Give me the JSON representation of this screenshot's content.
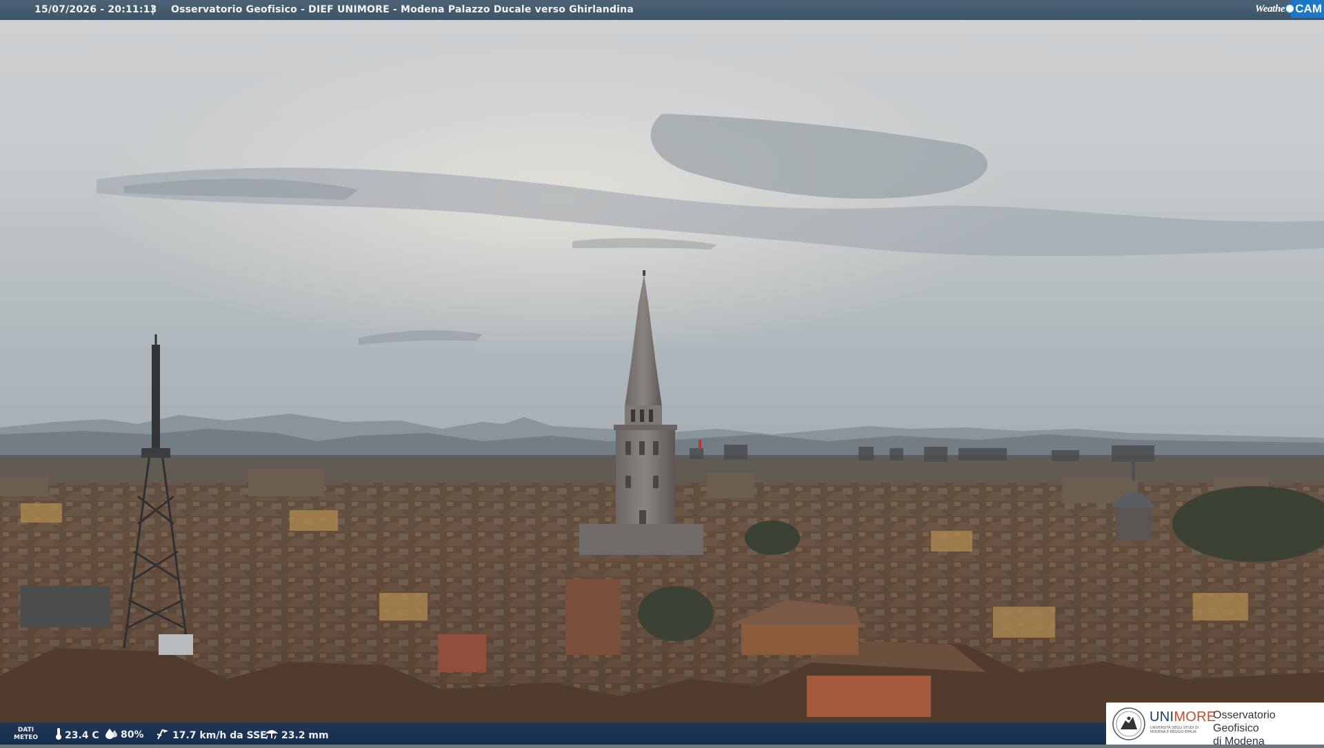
{
  "header": {
    "timestamp": "15/07/2026 - 20:11:13",
    "separator": "|",
    "camera_title": "Osservatorio Geofisico - DIEF UNIMORE - Modena Palazzo Ducale verso Ghirlandina",
    "logo": {
      "weather": "Weather",
      "cam": "CAM",
      "icon": "weathercam-logo"
    }
  },
  "weather_bar": {
    "section_label_line1": "DATI",
    "section_label_line2": "METEO",
    "temperature": {
      "icon": "thermometer-icon",
      "value": "23.4 C"
    },
    "humidity": {
      "icon": "humidity-drop-icon",
      "value": "80%"
    },
    "wind": {
      "icon": "wind-icon",
      "value": "17.7 km/h da SSE"
    },
    "rain": {
      "icon": "rain-icon",
      "value": "23.2 mm"
    }
  },
  "footer_logo": {
    "brand_uni": "UNI",
    "brand_more": "MORE",
    "brand_subtitle": "UNIVERSITÀ DEGLI STUDI DI MODENA E REGGIO EMILIA",
    "observatory_line1": "Osservatorio Geofisico",
    "observatory_line2": "di Modena",
    "seal_icon": "university-seal-icon"
  },
  "colors": {
    "topbar_bg": "#455a6d",
    "bottombar_bg": "#1b3a5e",
    "cam_blue": "#1c78c4",
    "unimore_red": "#c64c2a",
    "unimore_navy": "#203a66"
  }
}
